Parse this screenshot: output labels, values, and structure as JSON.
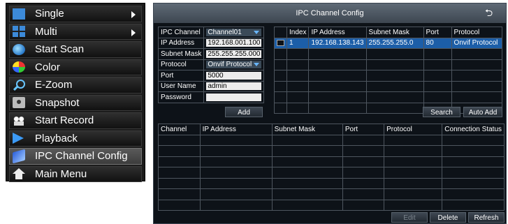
{
  "menu": {
    "items": [
      {
        "label": "Single",
        "icon": "single-view-icon",
        "submenu": true
      },
      {
        "label": "Multi",
        "icon": "multi-view-icon",
        "submenu": true
      },
      {
        "label": "Start Scan",
        "icon": "scan-icon"
      },
      {
        "label": "Color",
        "icon": "color-icon"
      },
      {
        "label": "E-Zoom",
        "icon": "zoom-icon"
      },
      {
        "label": "Snapshot",
        "icon": "snapshot-icon"
      },
      {
        "label": "Start Record",
        "icon": "record-icon"
      },
      {
        "label": "Playback",
        "icon": "playback-icon"
      },
      {
        "label": "IPC Channel Config",
        "icon": "ipc-icon",
        "active": true
      },
      {
        "label": "Main Menu",
        "icon": "home-icon"
      }
    ]
  },
  "dialog": {
    "title": "IPC Channel Config",
    "back_icon": "return-icon",
    "form": {
      "fields": [
        {
          "label": "IPC Channel",
          "value": "Channel01",
          "type": "select"
        },
        {
          "label": "IP Address",
          "value": "192.168.001.100",
          "type": "input"
        },
        {
          "label": "Subnet Mask",
          "value": "255.255.255.000",
          "type": "input"
        },
        {
          "label": "Protocol",
          "value": "Onvif Protocol",
          "type": "select"
        },
        {
          "label": "Port",
          "value": "5000",
          "type": "input"
        },
        {
          "label": "User Name",
          "value": "admin",
          "type": "input"
        },
        {
          "label": "Password",
          "value": "",
          "type": "input"
        }
      ],
      "add_label": "Add"
    },
    "results": {
      "headers": [
        "",
        "Index",
        "IP Address",
        "Subnet Mask",
        "Port",
        "Protocol"
      ],
      "rows": [
        {
          "index": "1",
          "ip": "192.168.138.143",
          "mask": "255.255.255.0",
          "port": "80",
          "protocol": "Onvif Protocol"
        }
      ],
      "search_label": "Search",
      "auto_add_label": "Auto Add"
    },
    "connections": {
      "headers": [
        "Channel",
        "IP Address",
        "Subnet Mask",
        "Port",
        "Protocol",
        "Connection Status"
      ],
      "rows": []
    },
    "footer": {
      "edit_label": "Edit",
      "delete_label": "Delete",
      "refresh_label": "Refresh"
    }
  },
  "colors": {
    "selected_row": "#1c5ea8",
    "dialog_bg": "#0d1218",
    "accent": "#3c8ad9"
  }
}
